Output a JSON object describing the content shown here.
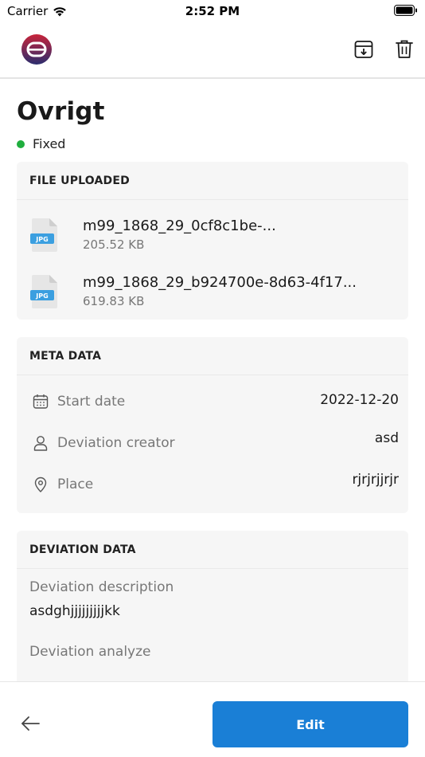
{
  "status_bar": {
    "carrier": "Carrier",
    "time": "2:52 PM"
  },
  "header": {
    "logo_icon": "app-logo-icon",
    "archive_icon": "archive-download-icon",
    "trash_icon": "trash-icon"
  },
  "page": {
    "title": "Ovrigt",
    "status_label": "Fixed",
    "status_color": "#1fae3e"
  },
  "files": {
    "header": "FILE UPLOADED",
    "items": [
      {
        "name": "m99_1868_29_0cf8c1be-...",
        "size": "205.52 KB",
        "type": "JPG"
      },
      {
        "name": "m99_1868_29_b924700e-8d63-4f17...",
        "size": "619.83 KB",
        "type": "JPG"
      }
    ]
  },
  "meta": {
    "header": "META DATA",
    "rows": [
      {
        "label": "Start date",
        "value": "2022-12-20",
        "icon": "calendar-icon"
      },
      {
        "label": "Deviation creator",
        "value": "asd",
        "icon": "user-icon"
      },
      {
        "label": "Place",
        "value": "rjrjrjjrjr",
        "icon": "location-pin-icon"
      }
    ]
  },
  "deviation": {
    "header": "DEVIATION DATA",
    "description_label": "Deviation description",
    "description_value": "asdghjjjjjjjjjkk",
    "analyze_label": "Deviation analyze"
  },
  "bottom": {
    "edit_label": "Edit",
    "back_icon": "arrow-left-icon",
    "accent": "#1a7fd6"
  }
}
